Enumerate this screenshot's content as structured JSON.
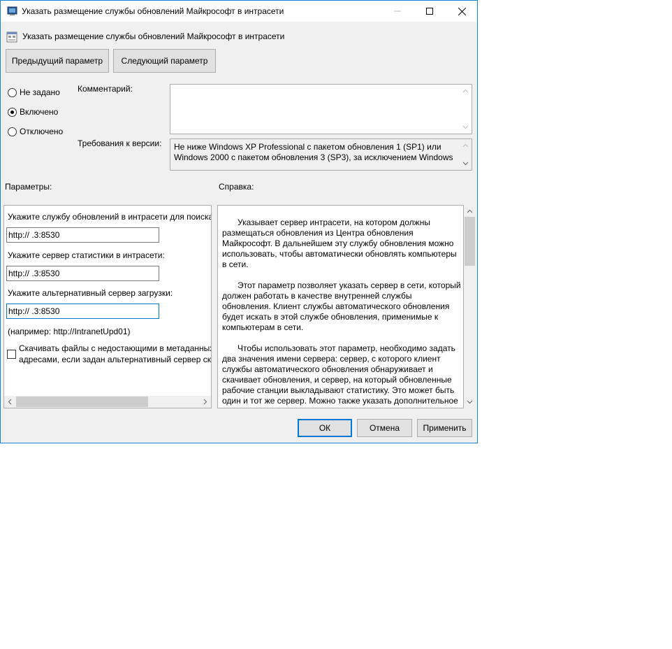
{
  "window": {
    "title": "Указать размещение службы обновлений Майкрософт в интрасети",
    "header": "Указать размещение службы обновлений Майкрософт в интрасети"
  },
  "nav": {
    "prev_label": "Предыдущий параметр",
    "next_label": "Следующий параметр"
  },
  "state": {
    "options": [
      {
        "label": "Не задано",
        "checked": false
      },
      {
        "label": "Включено",
        "checked": true
      },
      {
        "label": "Отключено",
        "checked": false
      }
    ]
  },
  "comment": {
    "label": "Комментарий:",
    "value": ""
  },
  "requirements": {
    "label": "Требования к версии:",
    "value": "Не ниже Windows XP Professional с пакетом обновления 1 (SP1) или Windows 2000 с пакетом обновления 3 (SP3), за исключением Windows"
  },
  "params": {
    "title": "Параметры:",
    "update_server_label": "Укажите службу обновлений в интрасети для поиска",
    "update_server_value": "http://             .3:8530",
    "stats_server_label": "Укажите сервер статистики в интрасети:",
    "stats_server_value": "http://             .3:8530",
    "alt_server_label": "Укажите альтернативный сервер загрузки:",
    "alt_server_value": "http://             .3:8530",
    "example": "(например: http://IntranetUpd01)",
    "download_checkbox_line1": "Скачивать файлы с недостающими в метаданных",
    "download_checkbox_line2": "адресами, если задан альтернативный сервер скач"
  },
  "help": {
    "title": "Справка:",
    "paragraphs": [
      "Указывает сервер интрасети, на котором должны размещаться обновления из Центра обновления Майкрософт. В дальнейшем эту службу обновления можно использовать, чтобы автоматически обновлять компьютеры в сети.",
      "Этот параметр позволяет указать сервер в сети, который должен работать в качестве внутренней службы обновления. Клиент службы автоматического обновления будет искать в этой службе обновления, применимые к компьютерам в сети.",
      "Чтобы использовать этот параметр, необходимо задать два значения имени сервера: сервер, с которого клиент службы автоматического обновления обнаруживает и скачивает обновления, и сервер, на который обновленные рабочие станции выкладывают статистику. Это может быть один и тот же сервер. Можно также указать дополнительное"
    ]
  },
  "footer": {
    "ok_label": "ОК",
    "cancel_label": "Отмена",
    "apply_label": "Применить"
  }
}
